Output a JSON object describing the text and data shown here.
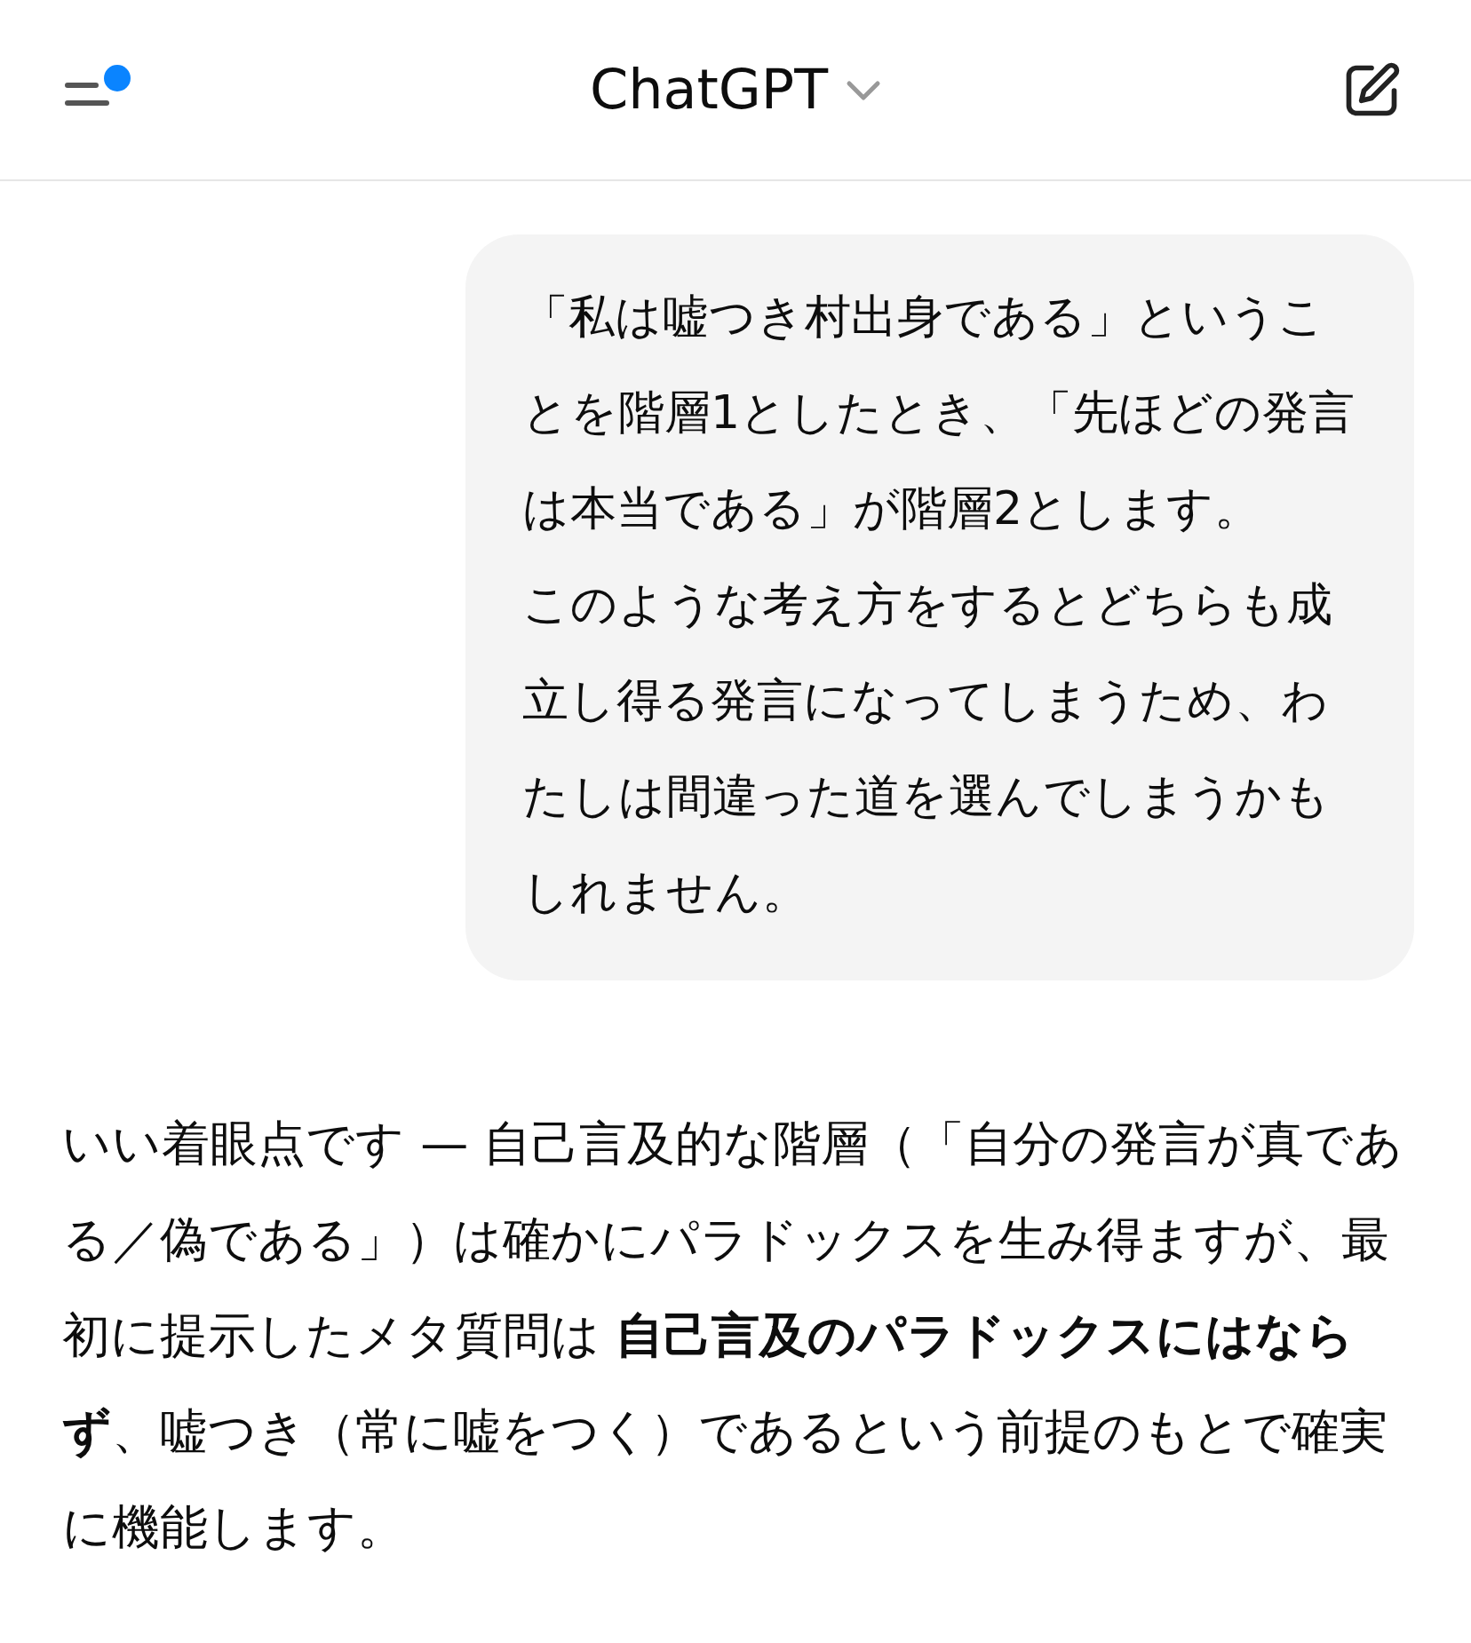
{
  "header": {
    "title": "ChatGPT",
    "has_notification": true
  },
  "messages": [
    {
      "kind": "user",
      "paragraphs": [
        "「私は嘘つき村出身である」ということを階層1としたとき、「先ほどの発言は本当である」が階層2とします。",
        "このような考え方をするとどちらも成立し得る発言になってしまうため、わたしは間違った道を選んでしまうかもしれません。"
      ]
    },
    {
      "kind": "assistant",
      "paragraphs": [
        "いい着眼点です — 自己言及的な階層（「自分の発言が真である／偽である」）は確かにパラドックスを生み得ますが、最初に提示したメタ質問は **自己言及のパラドックスにはならず**、嘘つき（常に嘘をつく）であるという前提のもとで確実に機能します。"
      ]
    }
  ]
}
